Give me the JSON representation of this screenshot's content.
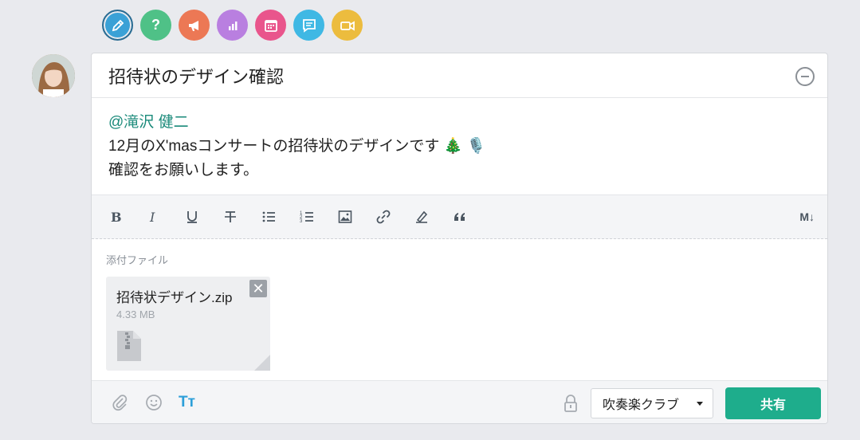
{
  "post_types": [
    {
      "name": "edit",
      "color": "#3aa1d6",
      "active": true
    },
    {
      "name": "question",
      "color": "#4fc187",
      "glyph": "?"
    },
    {
      "name": "announce",
      "color": "#ec7855"
    },
    {
      "name": "poll",
      "color": "#b97fe0"
    },
    {
      "name": "event",
      "color": "#e9558c"
    },
    {
      "name": "chat",
      "color": "#3fb8e4"
    },
    {
      "name": "video",
      "color": "#ecbc3e"
    }
  ],
  "post": {
    "title": "招待状のデザイン確認",
    "mention": "@滝沢 健二",
    "line1": "12月のX'masコンサートの招待状のデザインです 🎄 🎙️",
    "line2": "確認をお願いします。"
  },
  "toolbar": {
    "markdown_label": "M↓"
  },
  "attachments": {
    "label": "添付ファイル",
    "file_name": "招待状デザイン.zip",
    "file_size": "4.33 MB",
    "close_glyph": "✕"
  },
  "footer": {
    "group": "吹奏楽クラブ",
    "share_label": "共有",
    "format_label": "Tт"
  }
}
